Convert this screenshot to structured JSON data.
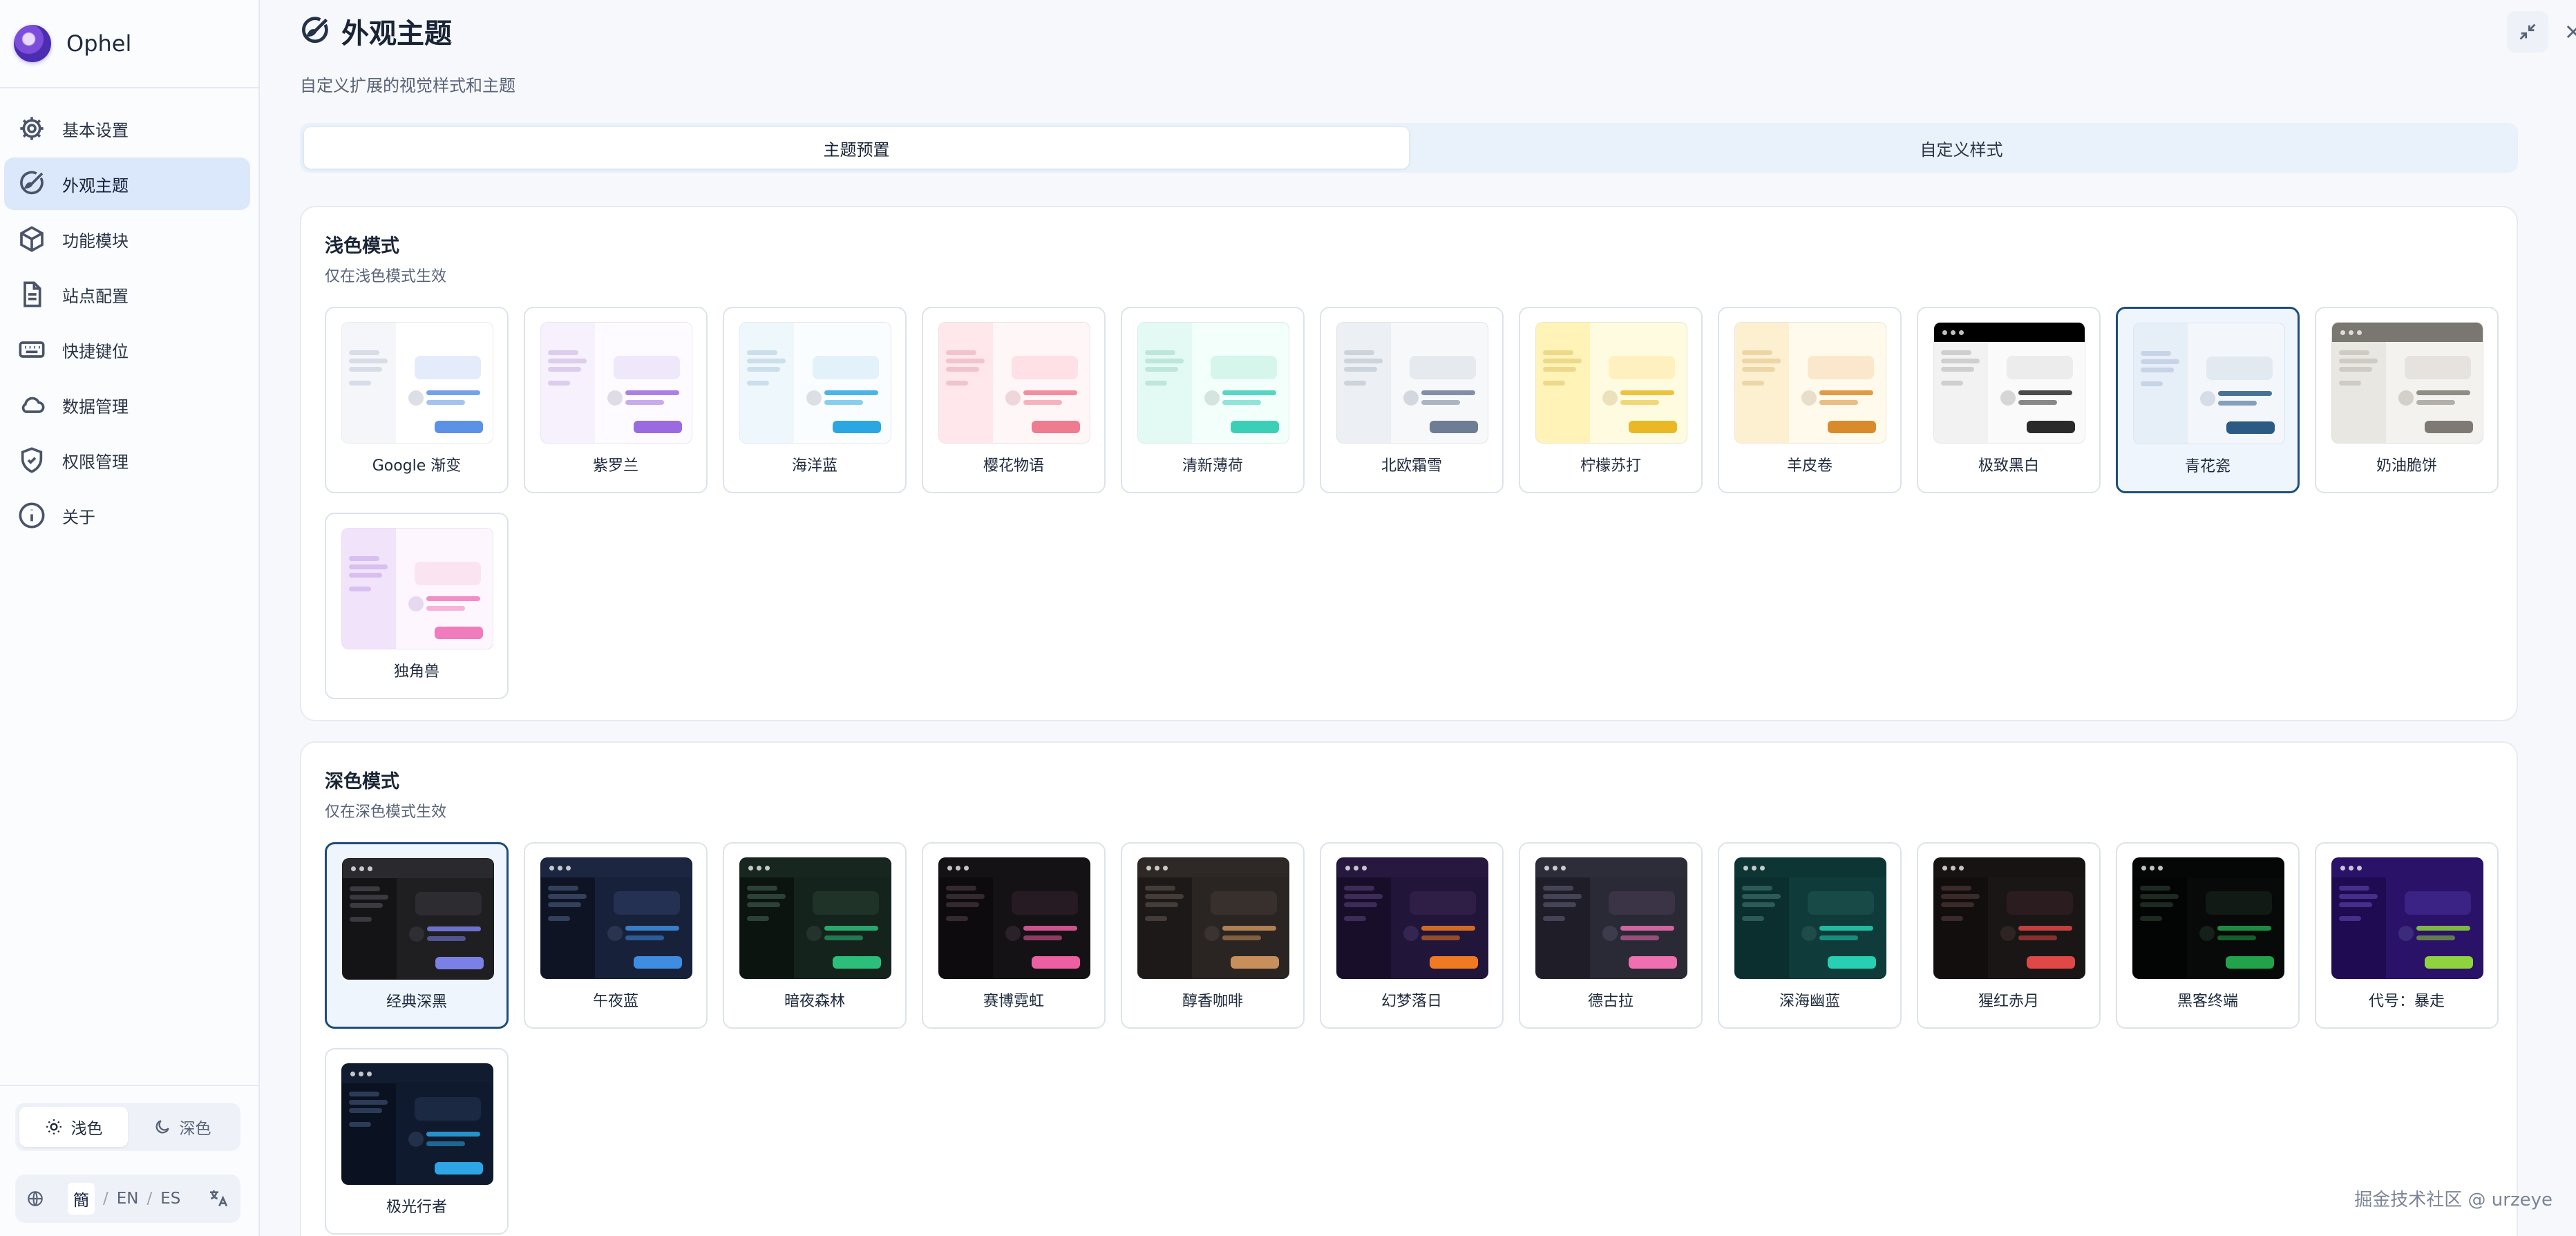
{
  "app": {
    "name": "Ophel"
  },
  "sidebar": {
    "items": [
      {
        "label": "基本设置",
        "icon": "gear-icon"
      },
      {
        "label": "外观主题",
        "icon": "palette-icon",
        "active": true
      },
      {
        "label": "功能模块",
        "icon": "cube-icon"
      },
      {
        "label": "站点配置",
        "icon": "document-icon"
      },
      {
        "label": "快捷键位",
        "icon": "keyboard-icon"
      },
      {
        "label": "数据管理",
        "icon": "cloud-icon"
      },
      {
        "label": "权限管理",
        "icon": "shield-icon"
      },
      {
        "label": "关于",
        "icon": "info-icon"
      }
    ],
    "mode": {
      "light": "浅色",
      "dark": "深色",
      "selected": "light"
    },
    "lang": {
      "options": [
        "簡",
        "EN",
        "ES"
      ],
      "selected": "簡"
    }
  },
  "header": {
    "title": "外观主题",
    "subtitle": "自定义扩展的视觉样式和主题"
  },
  "tabs": [
    {
      "label": "主题预置",
      "active": true
    },
    {
      "label": "自定义样式",
      "active": false
    }
  ],
  "light_section": {
    "title": "浅色模式",
    "subtitle": "仅在浅色模式生效",
    "themes": [
      {
        "name": "Google 渐变",
        "bg": "#ffffff",
        "side": "#f4f6fa",
        "line": "#d7dde7",
        "block": "#e4ecfb",
        "circle": "#dcdfe5",
        "accent": "#5b92e5",
        "bar": null
      },
      {
        "name": "紫罗兰",
        "bg": "#fdfbff",
        "side": "#f7f0fd",
        "line": "#dbcdeb",
        "block": "#efe8fb",
        "circle": "#e0dce7",
        "accent": "#9b6ae0",
        "bar": null
      },
      {
        "name": "海洋蓝",
        "bg": "#fafdff",
        "side": "#eef7fc",
        "line": "#cbdfeb",
        "block": "#e3f1fb",
        "circle": "#dbe0e4",
        "accent": "#2aa7e3",
        "bar": null
      },
      {
        "name": "樱花物语",
        "bg": "#fff6f7",
        "side": "#ffe7ec",
        "line": "#f0c4cd",
        "block": "#ffe0e6",
        "circle": "#eed6db",
        "accent": "#ee7b8f",
        "bar": null
      },
      {
        "name": "清新薄荷",
        "bg": "#f2fffb",
        "side": "#e2faf3",
        "line": "#bfe6da",
        "block": "#d6f6ec",
        "circle": "#d4e4df",
        "accent": "#3ccfb8",
        "bar": null
      },
      {
        "name": "北欧霜雪",
        "bg": "#f7f8fa",
        "side": "#eceff3",
        "line": "#cdd3db",
        "block": "#e6e9ee",
        "circle": "#d4d8de",
        "accent": "#6f7d94",
        "bar": null
      },
      {
        "name": "柠檬苏打",
        "bg": "#fffbe0",
        "side": "#fff3b8",
        "line": "#ecd98c",
        "block": "#fff0bf",
        "circle": "#ebe2bd",
        "accent": "#e9b824",
        "bar": null
      },
      {
        "name": "羊皮卷",
        "bg": "#fffaeb",
        "side": "#fdf0d0",
        "line": "#ecd6a8",
        "block": "#fbe8cc",
        "circle": "#e8dfcb",
        "accent": "#d98b2b",
        "bar": null
      },
      {
        "name": "极致黑白",
        "bg": "#fafafa",
        "side": "#f2f2f2",
        "line": "#cfcfcf",
        "block": "#ececec",
        "circle": "#d6d6d6",
        "accent": "#2a2a2a",
        "bar": "#000000"
      },
      {
        "name": "青花瓷",
        "bg": "#f3f7fc",
        "side": "#e6eef8",
        "line": "#c6d4e6",
        "block": "#e3e9f1",
        "circle": "#d6dde6",
        "accent": "#2b5a84",
        "bar": null,
        "selected": true
      },
      {
        "name": "奶油脆饼",
        "bg": "#f3f2ef",
        "side": "#e9e7e2",
        "line": "#cfcbc4",
        "block": "#e6e3de",
        "circle": "#d3d0ca",
        "accent": "#7e7a73",
        "bar": "#7a7670"
      },
      {
        "name": "独角兽",
        "bg": "#fdf6ff",
        "side": "#f1e3fa",
        "line": "#d8bff0",
        "block": "#fbe4f2",
        "circle": "#e6d8ef",
        "accent": "#f07bbd",
        "bar": null
      }
    ]
  },
  "dark_section": {
    "title": "深色模式",
    "subtitle": "仅在深色模式生效",
    "themes": [
      {
        "name": "经典深黑",
        "bg": "#1f1f22",
        "side": "#141416",
        "line": "#3a3a40",
        "block": "#2c2c31",
        "circle": "#2e2e33",
        "accent": "#7b80e6",
        "bar": "#2a2a2e",
        "selected": true
      },
      {
        "name": "午夜蓝",
        "bg": "#18213a",
        "side": "#0e1424",
        "line": "#33405c",
        "block": "#243152",
        "circle": "#2a3450",
        "accent": "#3f8de2",
        "bar": "#1c2640"
      },
      {
        "name": "暗夜森林",
        "bg": "#15231d",
        "side": "#0c1410",
        "line": "#2d4237",
        "block": "#1f3329",
        "circle": "#24342c",
        "accent": "#2bbf7b",
        "bar": "#17261f"
      },
      {
        "name": "赛博霓虹",
        "bg": "#151216",
        "side": "#0e0b0f",
        "line": "#34292f",
        "block": "#261b22",
        "circle": "#2a2228",
        "accent": "#ee5fa2",
        "bar": "#151216"
      },
      {
        "name": "醇香咖啡",
        "bg": "#2a2523",
        "side": "#1d1918",
        "line": "#443c38",
        "block": "#37302d",
        "circle": "#3a3330",
        "accent": "#c88f5a",
        "bar": "#2e2826"
      },
      {
        "name": "幻梦落日",
        "bg": "#22153a",
        "side": "#180e2a",
        "line": "#3d2c58",
        "block": "#2f1e45",
        "circle": "#342650",
        "accent": "#f07a21",
        "bar": "#26183e"
      },
      {
        "name": "德古拉",
        "bg": "#2a2936",
        "side": "#1f1e28",
        "line": "#454456",
        "block": "#3b3446",
        "circle": "#3e3c4c",
        "accent": "#f06fb0",
        "bar": "#2d2c39"
      },
      {
        "name": "深海幽蓝",
        "bg": "#0f3b3a",
        "side": "#0b2e2e",
        "line": "#2b5a58",
        "block": "#184a48",
        "circle": "#1f4b49",
        "accent": "#27d0b2",
        "bar": "#0d3534"
      },
      {
        "name": "猩红赤月",
        "bg": "#1b1616",
        "side": "#120e0e",
        "line": "#3a2a2a",
        "block": "#2b1d1f",
        "circle": "#2e2424",
        "accent": "#e04747",
        "bar": "#181313"
      },
      {
        "name": "黑客终端",
        "bg": "#070a08",
        "side": "#030504",
        "line": "#1d2a22",
        "block": "#121a15",
        "circle": "#16201a",
        "accent": "#22a34a",
        "bar": "#050706"
      },
      {
        "name": "代号：暴走",
        "bg": "#2a1268",
        "side": "#1e0b52",
        "line": "#44308a",
        "block": "#3b2385",
        "circle": "#3c2a7a",
        "accent": "#8fd43c",
        "bar": "#2a1268"
      },
      {
        "name": "极光行者",
        "bg": "#0f1a2e",
        "side": "#0a1222",
        "line": "#2c3b57",
        "block": "#1b2942",
        "circle": "#223049",
        "accent": "#2ea6e6",
        "bar": "#111c30"
      }
    ]
  },
  "watermark": "掘金技术社区 @ urzeye"
}
